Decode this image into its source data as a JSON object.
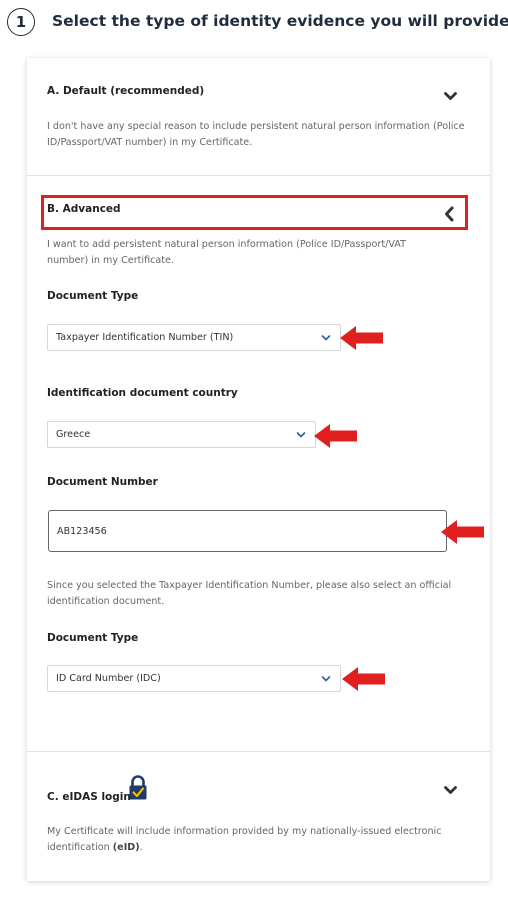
{
  "step": {
    "number": "1",
    "title": "Select the type of identity evidence you will provide"
  },
  "sections": {
    "default": {
      "title": "A. Default (recommended)",
      "description": "I don't have any special reason to include persistent natural person information (Police ID/Passport/VAT number) in my Certificate."
    },
    "advanced": {
      "title": "B. Advanced",
      "description": "I want to add persistent natural person information (Police ID/Passport/VAT number) in my Certificate.",
      "document_type_label": "Document Type",
      "document_type_value": "Taxpayer Identification Number (TIN)",
      "country_label": "Identification document country",
      "country_value": "Greece",
      "document_number_label": "Document Number",
      "document_number_value": "AB123456",
      "note": "Since you selected the Taxpayer Identification Number, please also select an official identification document.",
      "document_type2_label": "Document Type",
      "document_type2_value": "ID Card Number (IDC)"
    },
    "eidas": {
      "title": "C. eIDAS login",
      "description_prefix": "My Certificate will include information provided by my nationally-issued electronic identification ",
      "description_bold": "(eID)",
      "description_suffix": "."
    }
  },
  "icons": {
    "expand": "chevron-down-icon",
    "collapse": "chevron-left-icon",
    "lock": "lock-icon",
    "annotation_arrow": "arrow-left-icon"
  },
  "colors": {
    "accent": "#1f2d3d",
    "annotation_red": "#e0201e",
    "select_caret": "#2a5f9e"
  }
}
